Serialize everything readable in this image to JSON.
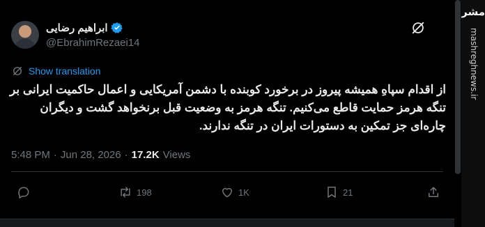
{
  "author": {
    "display_name": "ابراهیم رضایی",
    "handle": "@EbrahimRezaei14",
    "verified": true
  },
  "translate": {
    "label": "Show translation"
  },
  "tweet": {
    "text": "از اقدام سپاهِ همیشه پیروز در برخورد کوبنده با دشمن آمریکایی و اعمال حاکمیت ایرانی بر تنگه هرمز حمایت قاطع می‌کنیم. تنگه هرمز به وضعیت قبل برنخواهد گشت و دیگران چاره‌ای جز تمکین به دستورات ایران در تنگه ندارند.",
    "time": "5:48 PM",
    "date": "Jun 28, 2026",
    "separator": "·",
    "views_count": "17.2K",
    "views_label": "Views"
  },
  "actions": {
    "reply_count": "",
    "retweet_count": "198",
    "like_count": "1K",
    "bookmark_count": "21"
  },
  "watermark": {
    "logo_text": "مشرق",
    "url": "mashreghnews.ir"
  },
  "colors": {
    "background": "#000000",
    "text": "#e7e9ea",
    "muted": "#71767b",
    "accent": "#1d9bf0"
  }
}
